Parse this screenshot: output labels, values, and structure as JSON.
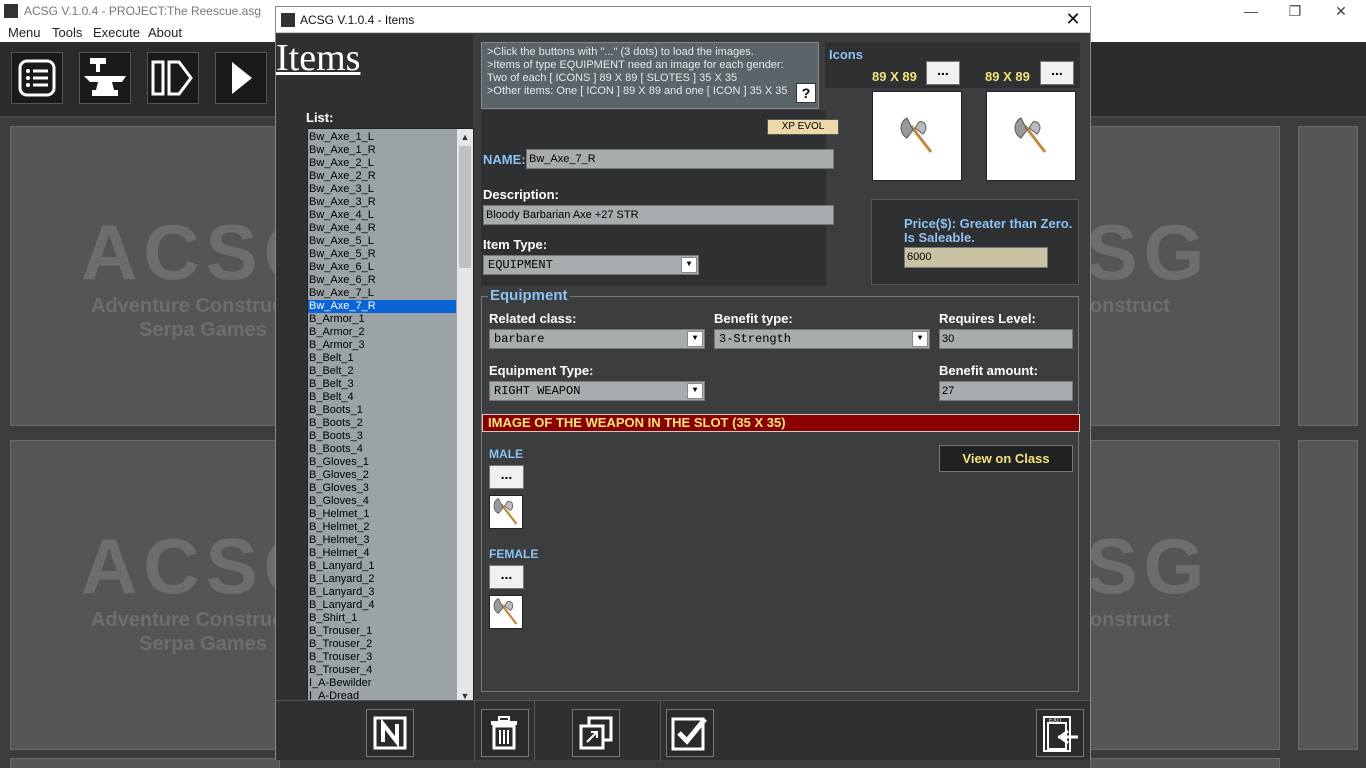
{
  "app": {
    "title": "ACSG V.1.0.4 - PROJECT:The Reescue.asg",
    "menu": [
      "Menu",
      "Tools",
      "Execute",
      "About"
    ],
    "window_buttons": {
      "minimize": "—",
      "restore": "❐",
      "close": "✕"
    },
    "watermark": {
      "logo": "ACSG",
      "line1": "Adventure Construct",
      "line2": "Serpa Games"
    }
  },
  "dialog": {
    "title": "ACSG V.1.0.4 - Items",
    "close_glyph": "✕",
    "heading": "Items",
    "list_label": "List:",
    "list_items": [
      "Bw_Axe_1_L",
      "Bw_Axe_1_R",
      "Bw_Axe_2_L",
      "Bw_Axe_2_R",
      "Bw_Axe_3_L",
      "Bw_Axe_3_R",
      "Bw_Axe_4_L",
      "Bw_Axe_4_R",
      "Bw_Axe_5_L",
      "Bw_Axe_5_R",
      "Bw_Axe_6_L",
      "Bw_Axe_6_R",
      "Bw_Axe_7_L",
      "Bw_Axe_7_R",
      "B_Armor_1",
      "B_Armor_2",
      "B_Armor_3",
      "B_Belt_1",
      "B_Belt_2",
      "B_Belt_3",
      "B_Belt_4",
      "B_Boots_1",
      "B_Boots_2",
      "B_Boots_3",
      "B_Boots_4",
      "B_Gloves_1",
      "B_Gloves_2",
      "B_Gloves_3",
      "B_Gloves_4",
      "B_Helmet_1",
      "B_Helmet_2",
      "B_Helmet_3",
      "B_Helmet_4",
      "B_Lanyard_1",
      "B_Lanyard_2",
      "B_Lanyard_3",
      "B_Lanyard_4",
      "B_Shirt_1",
      "B_Trouser_1",
      "B_Trouser_2",
      "B_Trouser_3",
      "B_Trouser_4",
      "I_A-Bewilder",
      "I_A-Dread"
    ],
    "selected_item": "Bw_Axe_7_R",
    "info_lines": [
      ">Click the buttons with \"...\" (3 dots) to load the images.",
      ">Items of type EQUIPMENT need an image for each gender:",
      "Two of each [ ICONS ] 89 X 89 [ SLOTES ] 35 X 35",
      ">Other items: One [ ICON ] 89 X 89 and one [ ICON ] 35 X 35"
    ],
    "help_label": "?",
    "icons_label": "Icons",
    "icon_size_1": "89 X 89",
    "icon_size_2": "89 X 89",
    "dots_label": "...",
    "xp_evol_label": "XP EVOL",
    "name_label": "NAME:",
    "name_value": "Bw_Axe_7_R",
    "description_label": "Description:",
    "description_value": "Bloody Barbarian Axe +27 STR",
    "item_type_label": "Item Type:",
    "item_type_value": "EQUIPMENT",
    "price_label_1": "Price($): Greater than Zero.",
    "price_label_2": "Is Saleable.",
    "price_value": "6000",
    "equipment": {
      "title": "Equipment",
      "related_class_label": "Related class:",
      "related_class_value": "barbare",
      "benefit_type_label": "Benefit type:",
      "benefit_type_value": "3-Strength",
      "requires_level_label": "Requires Level:",
      "requires_level_value": "30",
      "equipment_type_label": "Equipment Type:",
      "equipment_type_value": "RIGHT WEAPON",
      "benefit_amount_label": "Benefit amount:",
      "benefit_amount_value": "27",
      "slot_banner": "IMAGE OF THE WEAPON IN THE SLOT (35 X 35)",
      "male_label": "MALE",
      "female_label": "FEMALE",
      "view_on_class_label": "View on Class"
    },
    "dropdown_glyph": "▼",
    "scroll_up": "▲",
    "scroll_down": "▼"
  },
  "colors": {
    "accent_blue": "#8cc1f2",
    "accent_yellow": "#f5e27a",
    "banner_red": "#8a0000",
    "selection_blue": "#0a64d8"
  }
}
